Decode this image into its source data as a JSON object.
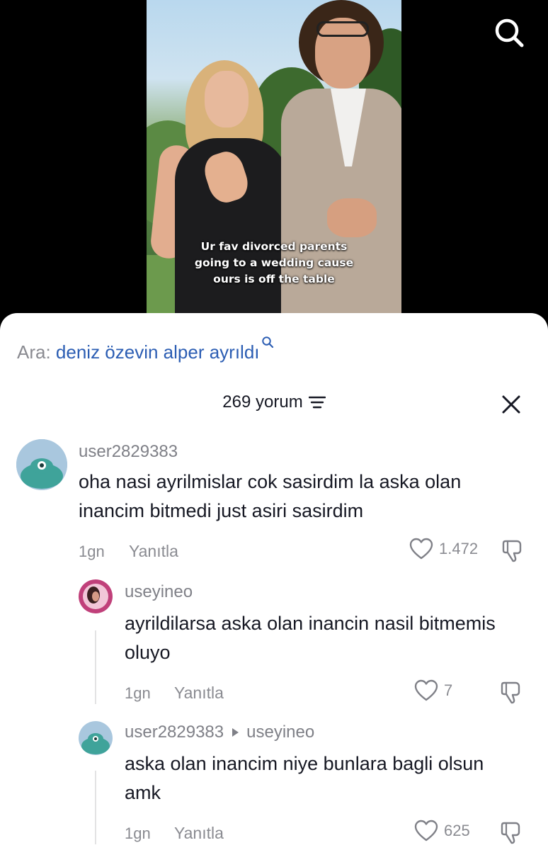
{
  "video": {
    "caption_lines": [
      "Ur fav divorced parents",
      "going to a wedding cause",
      "ours is off the table"
    ],
    "search_icon": "search-icon"
  },
  "search_suggestion": {
    "prefix": "Ara:",
    "query": "deniz özevin alper ayrıldı"
  },
  "comments_header": {
    "count_label": "269 yorum",
    "sort_icon": "sort-lines-icon",
    "close_icon": "close-icon"
  },
  "comments": [
    {
      "username": "user2829383",
      "text": "oha nasi ayrilmislar cok sasirdim la aska olan inancim bitmedi just asiri sasirdim",
      "time": "1gn",
      "reply_label": "Yanıtla",
      "likes": "1.472"
    }
  ],
  "replies": [
    {
      "username": "useyineo",
      "text": "ayrildilarsa aska olan inancin nasil bitmemis oluyo",
      "time": "1gn",
      "reply_label": "Yanıtla",
      "likes": "7"
    },
    {
      "username": "user2829383",
      "reply_to": "useyineo",
      "text": "aska olan inancim niye bunlara bagli olsun amk",
      "time": "1gn",
      "reply_label": "Yanıtla",
      "likes": "625"
    }
  ],
  "colors": {
    "query_link": "#2b5db3",
    "muted_text": "#8a8b91",
    "avatar_teal": "#3fa39a",
    "avatar_pink": "#c0407a"
  }
}
